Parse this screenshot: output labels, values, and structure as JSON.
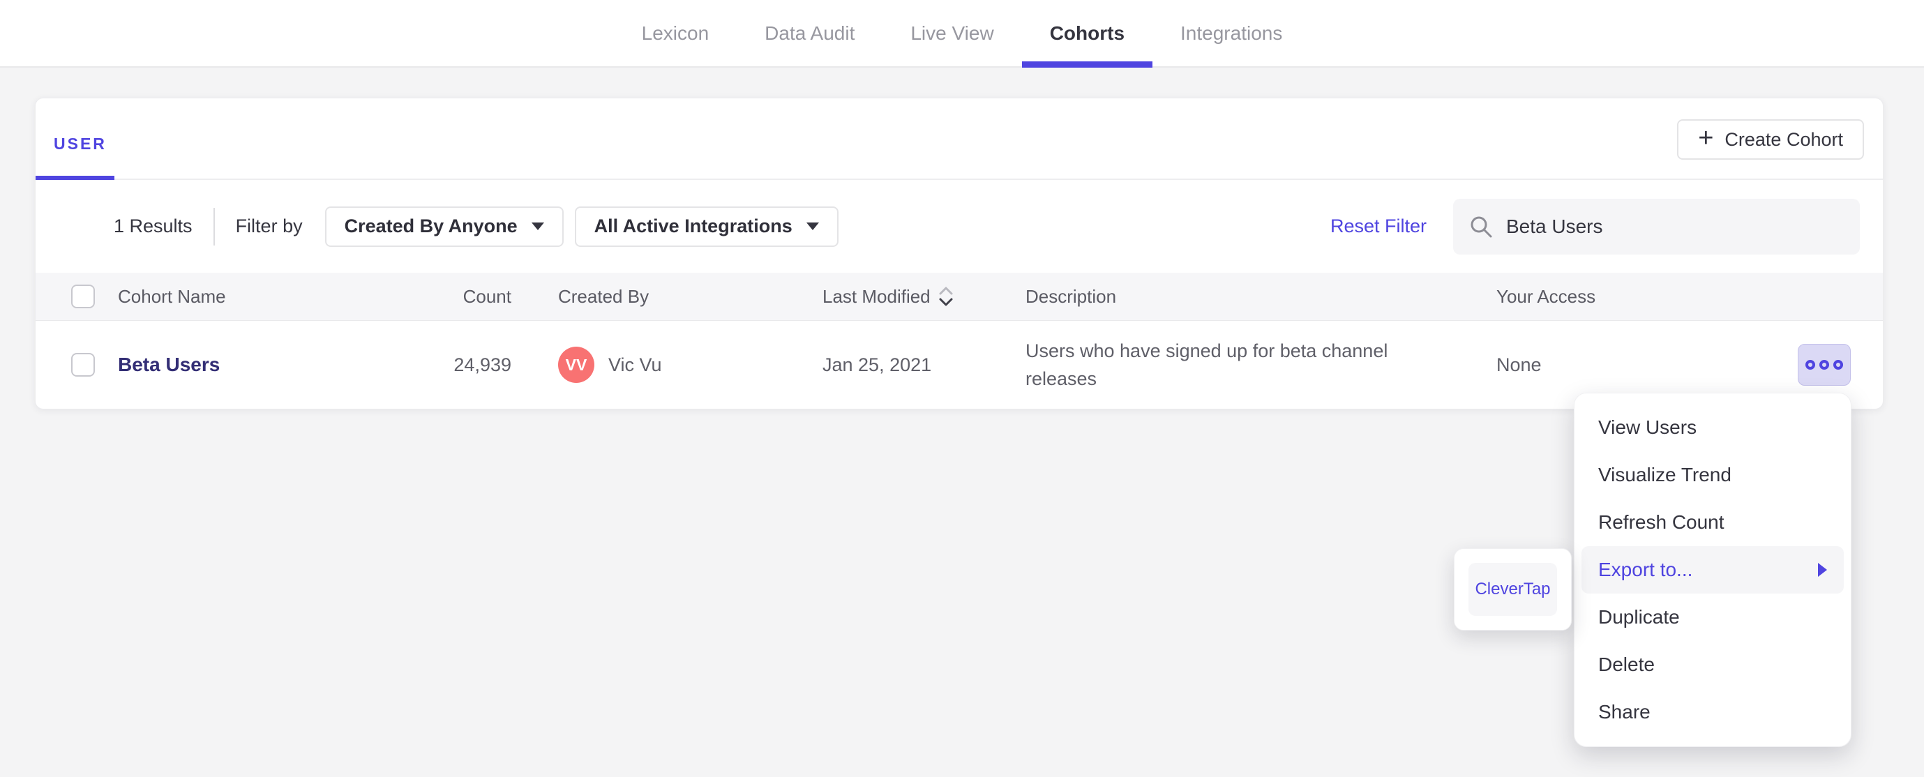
{
  "nav": {
    "tabs": [
      {
        "label": "Lexicon",
        "active": false
      },
      {
        "label": "Data Audit",
        "active": false
      },
      {
        "label": "Live View",
        "active": false
      },
      {
        "label": "Cohorts",
        "active": true
      },
      {
        "label": "Integrations",
        "active": false
      }
    ]
  },
  "cohorts_page": {
    "type_tab_label": "USER",
    "create_button_label": "Create Cohort",
    "plus_glyph": "+",
    "filter_bar": {
      "results_count": "1 Results",
      "filter_by_label": "Filter by",
      "created_by_dropdown_value": "Created By Anyone",
      "integrations_dropdown_value": "All Active Integrations",
      "reset_filter_label": "Reset Filter",
      "search_value": "Beta Users"
    },
    "table": {
      "columns": {
        "name": "Cohort Name",
        "count": "Count",
        "created_by": "Created By",
        "last_modified": "Last Modified",
        "description": "Description",
        "your_access": "Your Access"
      },
      "rows": [
        {
          "name": "Beta Users",
          "count": "24,939",
          "created_by_initials": "VV",
          "created_by_name": "Vic Vu",
          "last_modified": "Jan 25, 2021",
          "description": "Users who have signed up for beta channel releases",
          "your_access": "None"
        }
      ]
    }
  },
  "context_menu": {
    "items": [
      "View Users",
      "Visualize Trend",
      "Refresh Count",
      "Export to...",
      "Duplicate",
      "Delete",
      "Share"
    ],
    "highlighted_item": "Export to...",
    "submenu_items": [
      "CleverTap"
    ]
  },
  "colors": {
    "accent_purple": "#4f44e0",
    "cohort_link": "#332e75",
    "avatar_coral": "#f87272",
    "page_background": "#f4f4f5"
  }
}
